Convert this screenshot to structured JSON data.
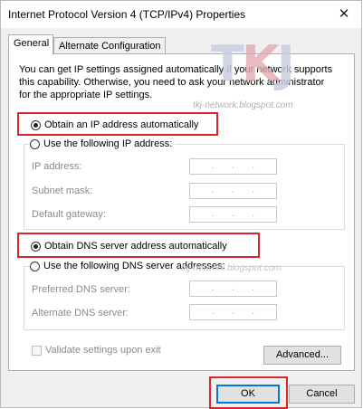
{
  "window": {
    "title": "Internet Protocol Version 4 (TCP/IPv4) Properties",
    "close_glyph": "✕"
  },
  "tabs": [
    {
      "label": "General",
      "active": true
    },
    {
      "label": "Alternate Configuration",
      "active": false
    }
  ],
  "description": "You can get IP settings assigned automatically if your network supports this capability. Otherwise, you need to ask your network administrator for the appropriate IP settings.",
  "ip_section": {
    "auto_label": "Obtain an IP address automatically",
    "auto_selected": true,
    "manual_label": "Use the following IP address:",
    "manual_selected": false,
    "fields": [
      {
        "label": "IP address:",
        "value": ". . ."
      },
      {
        "label": "Subnet mask:",
        "value": ". . ."
      },
      {
        "label": "Default gateway:",
        "value": ". . ."
      }
    ]
  },
  "dns_section": {
    "auto_label": "Obtain DNS server address automatically",
    "auto_selected": true,
    "manual_label": "Use the following DNS server addresses:",
    "manual_selected": false,
    "fields": [
      {
        "label": "Preferred DNS server:",
        "value": ". . ."
      },
      {
        "label": "Alternate DNS server:",
        "value": ". . ."
      }
    ]
  },
  "validate": {
    "label": "Validate settings upon exit",
    "checked": false,
    "enabled": false
  },
  "buttons": {
    "advanced": "Advanced...",
    "ok": "OK",
    "cancel": "Cancel"
  },
  "watermark": {
    "logo": "TKJ",
    "url": "tkj-network.blogspot.com"
  },
  "colors": {
    "highlight": "#d9262a",
    "focus": "#0078d7",
    "panel_bg": "#ffffff",
    "dialog_bg": "#f0f0f0"
  }
}
